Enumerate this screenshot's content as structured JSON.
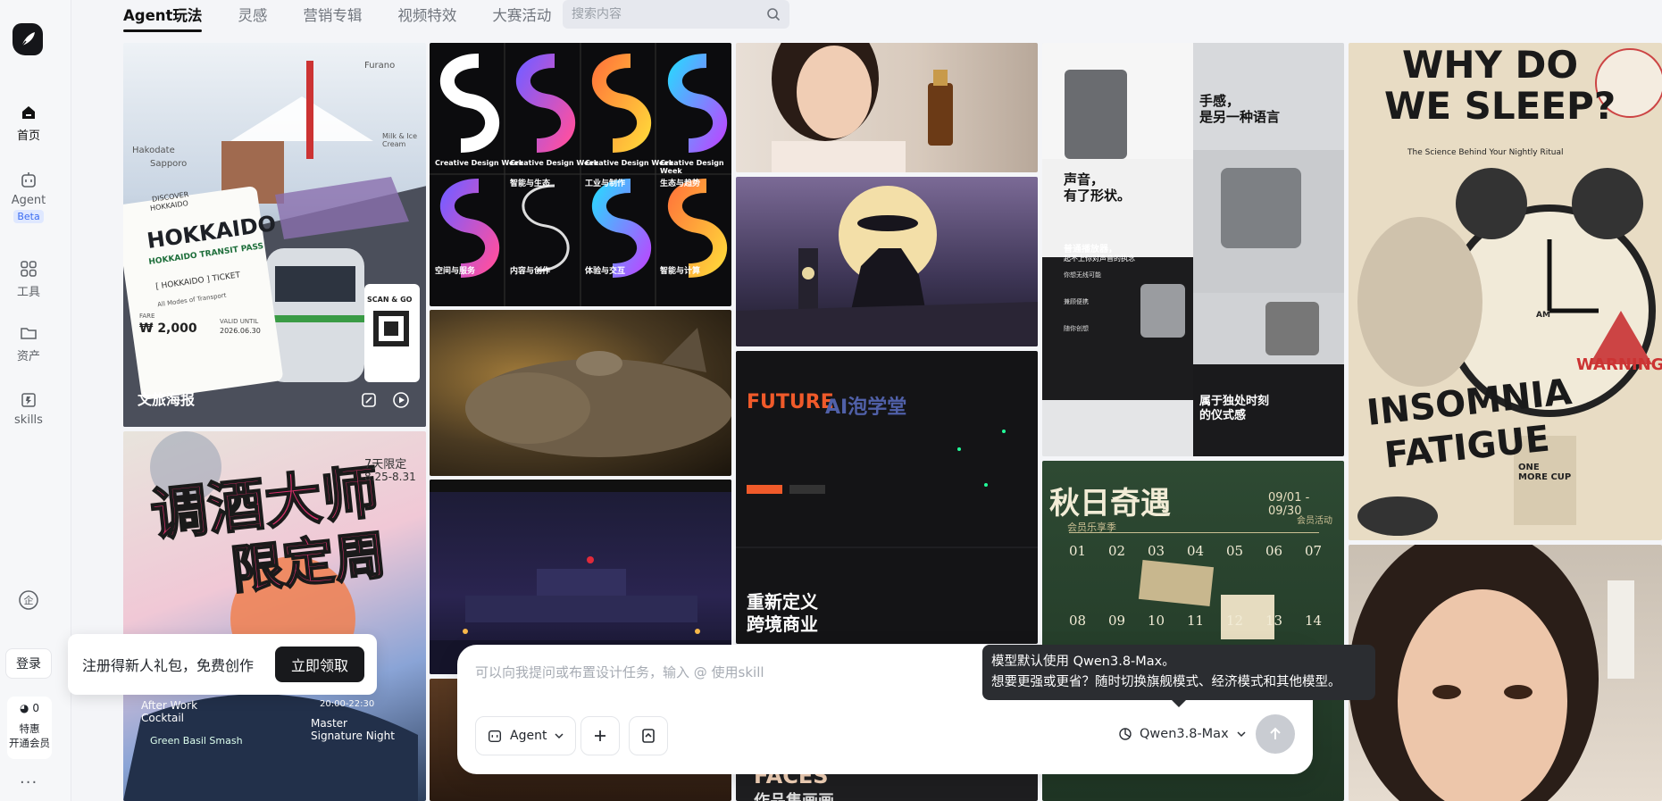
{
  "tabs": [
    "Agent玩法",
    "灵感",
    "营销专辑",
    "视频特效",
    "大赛活动"
  ],
  "search": {
    "placeholder": "搜索内容"
  },
  "sidebar": {
    "items": [
      {
        "label": "首页",
        "icon": "home-icon"
      },
      {
        "label": "Agent",
        "icon": "agent-icon",
        "badge": "Beta"
      },
      {
        "label": "工具",
        "icon": "grid-icon"
      },
      {
        "label": "资产",
        "icon": "folder-icon"
      },
      {
        "label": "skills",
        "icon": "skills-icon"
      }
    ],
    "enterprise_icon": "enterprise-icon",
    "login": "登录",
    "credits": {
      "count": "0",
      "line1": "特惠",
      "line2": "开通会员"
    },
    "more": "···"
  },
  "gallery": {
    "card1": {
      "label": "文旅海报",
      "text": {
        "sapporo": "Sapporo",
        "furano": "Furano",
        "hakodate": "Hakodate",
        "milk": "Milk & Ice Cream",
        "discover": "DISCOVER",
        "hokkaido_small": "HOKKAIDO",
        "title": "HOKKAIDO",
        "pass": "HOKKAIDO TRANSIT PASS",
        "ticket": "[ HOKKAIDO ] TICKET",
        "modes": "All Modes of Transport",
        "fare": "FARE",
        "price": "₩ 2,000",
        "valid": "VALID UNTIL",
        "date": "2026.06.30",
        "scan": "SCAN & GO"
      }
    },
    "card2": {
      "title": "调酒大师",
      "sub": "限定周",
      "days": "7天限定",
      "dates": "8.25-8.31",
      "event1": "After Work Cocktail",
      "event2": "Master Signature Night",
      "event3": "Green Basil Smash",
      "time1": "20:00-22:30"
    },
    "card3": {
      "week": "Creative Design Week",
      "cells": [
        [
          "智能与生态",
          "工业与制作",
          "生态与趋势"
        ],
        [
          "空间与服务",
          "内容与创作",
          "体验与交互",
          "智能与计算"
        ]
      ]
    },
    "card5": {
      "h1": "声音，",
      "h2": "有了形状。",
      "h3": "手感，",
      "h4": "是另一种语言",
      "h5": "属于独处时刻",
      "h6": "的仪式感",
      "l1": "普通播放器，",
      "l2": "起不上你对声音的执念",
      "b1": "你想无线可能",
      "b2": "兼顾便携",
      "b3": "随你创想"
    },
    "card7": {
      "title": "重新定义",
      "sub": "跨境商业",
      "future": "FUTURE",
      "brand": "AI泡学堂"
    },
    "card8": {
      "title": "秋日奇遇",
      "sub": "会员乐享季",
      "dates": "09/01 - 09/30",
      "member": "会员活动",
      "days": [
        "01",
        "02",
        "03",
        "04",
        "05",
        "06",
        "07",
        "08",
        "09",
        "10",
        "11",
        "12",
        "13",
        "14"
      ]
    },
    "card9": {
      "t1": "WHY DO",
      "t2": "WE SLEEP?",
      "sub": "The Science Behind Your Nightly Ritual",
      "t3": "INSOMNIA",
      "t4": "FATIGUE",
      "warn": "WARNING",
      "cup": "ONE MORE CUP",
      "am": "AM"
    },
    "card10": {
      "text": "FACES",
      "sub": "作品集画画"
    }
  },
  "promo": {
    "text": "注册得新人礼包，免费创作",
    "button": "立即领取"
  },
  "composer": {
    "placeholder": "可以向我提问或布置设计任务，输入 @ 使用skill",
    "agent": "Agent",
    "model": "Qwen3.8-Max"
  },
  "tooltip": {
    "line1": "模型默认使用 Qwen3.8-Max。",
    "line2": "想要更强或更省？随时切换旗舰模式、经济模式和其他模型。"
  },
  "colors": {
    "accent": "#18191c",
    "beta_bg": "#dfe8ff",
    "beta_text": "#3b6cf2",
    "tooltip_bg": "#2b2d31"
  }
}
